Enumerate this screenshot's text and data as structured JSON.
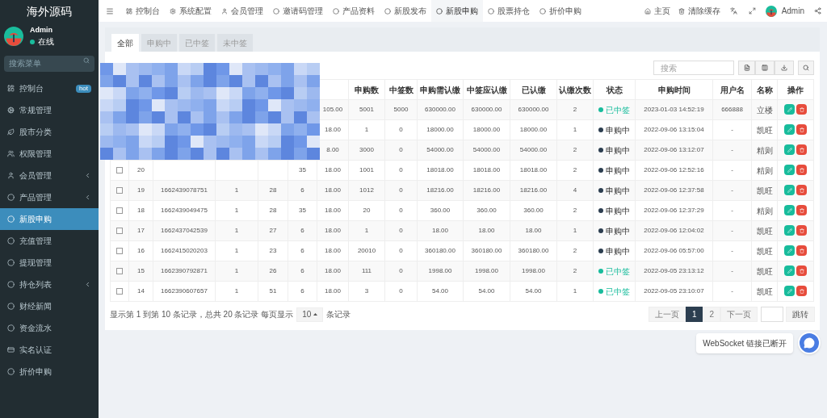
{
  "sidebar": {
    "logo": "海外源码",
    "user": {
      "name": "Admin",
      "status": "在线"
    },
    "search": {
      "placeholder": "搜索菜单"
    },
    "items": [
      {
        "label": "控制台",
        "badge": "hot",
        "expandable": false,
        "selected": false
      },
      {
        "label": "常规管理",
        "expandable": false,
        "selected": false
      },
      {
        "label": "股市分类",
        "expandable": false,
        "selected": false
      },
      {
        "label": "权限管理",
        "expandable": false,
        "selected": false
      },
      {
        "label": "会员管理",
        "expandable": true,
        "selected": false
      },
      {
        "label": "产品管理",
        "expandable": true,
        "selected": false
      },
      {
        "label": "新股申购",
        "expandable": false,
        "selected": true
      },
      {
        "label": "充值管理",
        "expandable": false,
        "selected": false
      },
      {
        "label": "提现管理",
        "expandable": false,
        "selected": false
      },
      {
        "label": "持仓列表",
        "expandable": true,
        "selected": false
      },
      {
        "label": "财经新闻",
        "expandable": false,
        "selected": false
      },
      {
        "label": "资金流水",
        "expandable": false,
        "selected": false
      },
      {
        "label": "实名认证",
        "expandable": false,
        "selected": false
      },
      {
        "label": "折价申购",
        "expandable": false,
        "selected": false
      }
    ]
  },
  "topbar": {
    "tabs": [
      {
        "label": "控制台",
        "selected": false
      },
      {
        "label": "系统配置",
        "selected": false
      },
      {
        "label": "会员管理",
        "selected": false
      },
      {
        "label": "邀请码管理",
        "selected": false
      },
      {
        "label": "产品资料",
        "selected": false
      },
      {
        "label": "新股发布",
        "selected": false
      },
      {
        "label": "新股申购",
        "selected": true
      },
      {
        "label": "股票持仓",
        "selected": false
      },
      {
        "label": "折价申购",
        "selected": false
      }
    ],
    "links": [
      "主页",
      "清除缓存"
    ],
    "user": "Admin"
  },
  "filter_tabs": [
    {
      "label": "全部",
      "selected": true
    },
    {
      "label": "申购中",
      "selected": false
    },
    {
      "label": "已中签",
      "selected": false
    },
    {
      "label": "未中签",
      "selected": false
    }
  ],
  "search": {
    "placeholder": "搜索"
  },
  "table": {
    "columns": [
      "申购数",
      "中签数",
      "申购需认缴",
      "中签应认缴",
      "已认缴",
      "认缴次数",
      "状态",
      "申购时间",
      "用户名",
      "名称",
      "操作"
    ],
    "rows": [
      {
        "price": "105.00",
        "cells": [
          "5001",
          "5000",
          "630000.00",
          "630000.00",
          "630000.00",
          "2"
        ],
        "status": {
          "label": "已中签",
          "kind": "won"
        },
        "time": "2023-01-03 14:52:19",
        "username": "666888",
        "name": "立楼"
      },
      {
        "price": "18.00",
        "cells": [
          "1",
          "0",
          "18000.00",
          "18000.00",
          "18000.00",
          "1"
        ],
        "status": {
          "label": "申购中",
          "kind": "pending"
        },
        "time": "2022-09-06 13:15:04",
        "username": "-",
        "name": "凯旺"
      },
      {
        "price": "8.00",
        "cells": [
          "3000",
          "0",
          "54000.00",
          "54000.00",
          "54000.00",
          "2"
        ],
        "status": {
          "label": "申购中",
          "kind": "pending"
        },
        "time": "2022-09-06 13:12:07",
        "username": "-",
        "name": "精则"
      },
      {
        "checked": false,
        "id": "20",
        "column_6": "35",
        "price": "18.00",
        "cells": [
          "1001",
          "0",
          "18018.00",
          "18018.00",
          "18018.00",
          "2"
        ],
        "status": {
          "label": "申购中",
          "kind": "pending"
        },
        "time": "2022-09-06 12:52:16",
        "username": "-",
        "name": "精则"
      },
      {
        "checked": false,
        "id": "19",
        "order_no": "1662439078751",
        "column_4": "1",
        "column_5": "28",
        "column_6": "6",
        "price": "18.00",
        "cells": [
          "1012",
          "0",
          "18216.00",
          "18216.00",
          "18216.00",
          "4"
        ],
        "status": {
          "label": "申购中",
          "kind": "pending"
        },
        "time": "2022-09-06 12:37:58",
        "username": "-",
        "name": "凯旺"
      },
      {
        "checked": false,
        "id": "18",
        "order_no": "1662439049475",
        "column_4": "1",
        "column_5": "28",
        "column_6": "35",
        "price": "18.00",
        "cells": [
          "20",
          "0",
          "360.00",
          "360.00",
          "360.00",
          "2"
        ],
        "status": {
          "label": "申购中",
          "kind": "pending"
        },
        "time": "2022-09-06 12:37:29",
        "username": "-",
        "name": "精则"
      },
      {
        "checked": false,
        "id": "17",
        "order_no": "1662437042539",
        "column_4": "1",
        "column_5": "27",
        "column_6": "6",
        "price": "18.00",
        "cells": [
          "1",
          "0",
          "18.00",
          "18.00",
          "18.00",
          "1"
        ],
        "status": {
          "label": "申购中",
          "kind": "pending"
        },
        "time": "2022-09-06 12:04:02",
        "username": "-",
        "name": "凯旺"
      },
      {
        "checked": false,
        "id": "16",
        "order_no": "1662415020203",
        "column_4": "1",
        "column_5": "23",
        "column_6": "6",
        "price": "18.00",
        "cells": [
          "20010",
          "0",
          "360180.00",
          "360180.00",
          "360180.00",
          "2"
        ],
        "status": {
          "label": "申购中",
          "kind": "pending"
        },
        "time": "2022-09-06 05:57:00",
        "username": "-",
        "name": "凯旺"
      },
      {
        "checked": false,
        "id": "15",
        "order_no": "1662390792871",
        "column_4": "1",
        "column_5": "26",
        "column_6": "6",
        "price": "18.00",
        "cells": [
          "111",
          "0",
          "1998.00",
          "1998.00",
          "1998.00",
          "2"
        ],
        "status": {
          "label": "已中签",
          "kind": "won"
        },
        "time": "2022-09-05 23:13:12",
        "username": "-",
        "name": "凯旺"
      },
      {
        "checked": false,
        "id": "14",
        "order_no": "1662390607657",
        "column_4": "1",
        "column_5": "51",
        "column_6": "6",
        "price": "18.00",
        "cells": [
          "3",
          "0",
          "54.00",
          "54.00",
          "54.00",
          "1"
        ],
        "status": {
          "label": "已中签",
          "kind": "won"
        },
        "time": "2022-09-05 23:10:07",
        "username": "-",
        "name": "凯旺"
      }
    ]
  },
  "pagination": {
    "summary": "显示第 1 到第 10 条记录，总共 20 条记录 每页显示",
    "page_size": "10",
    "summary_end": "条记录",
    "buttons": [
      {
        "label": "上一页",
        "selected": false
      },
      {
        "label": "1",
        "selected": true
      },
      {
        "label": "2",
        "selected": false
      },
      {
        "label": "下一页",
        "selected": false
      }
    ],
    "go": "跳转"
  },
  "toast": "WebSocket 链接已断开"
}
